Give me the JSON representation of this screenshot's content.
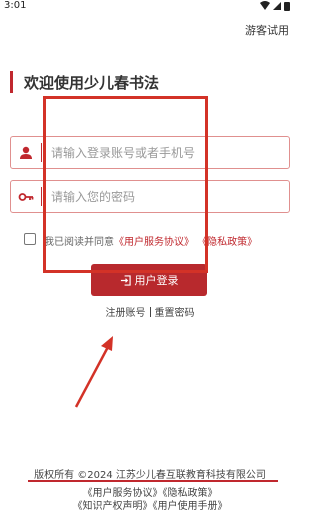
{
  "status_bar": {
    "time": "3:01"
  },
  "header": {
    "guest_label": "游客试用"
  },
  "welcome": {
    "title": "欢迎使用少儿春书法"
  },
  "form": {
    "account_placeholder": "请输入登录账号或者手机号",
    "account_value": "",
    "password_placeholder": "请输入您的密码",
    "password_value": ""
  },
  "agreement": {
    "checked": false,
    "prefix": "我已阅读并同意",
    "service_link": "《用户服务协议》",
    "privacy_link": "《隐私政策》"
  },
  "login_button": {
    "label": "用户登录"
  },
  "links": {
    "register": "注册账号",
    "reset": "重置密码"
  },
  "footer": {
    "copyright": "版权所有 ©2024 江苏少儿春互联教育科技有限公司",
    "line2_service": "《用户服务协议》",
    "line2_privacy": "《隐私政策》",
    "line3_ip": "《知识产权声明》",
    "line3_manual": "《用户使用手册》"
  },
  "colors": {
    "accent": "#c0282e",
    "annotation": "#d33227"
  },
  "icons": [
    "wifi-icon",
    "signal-icon",
    "battery-icon",
    "user-icon",
    "key-icon",
    "login-icon"
  ]
}
